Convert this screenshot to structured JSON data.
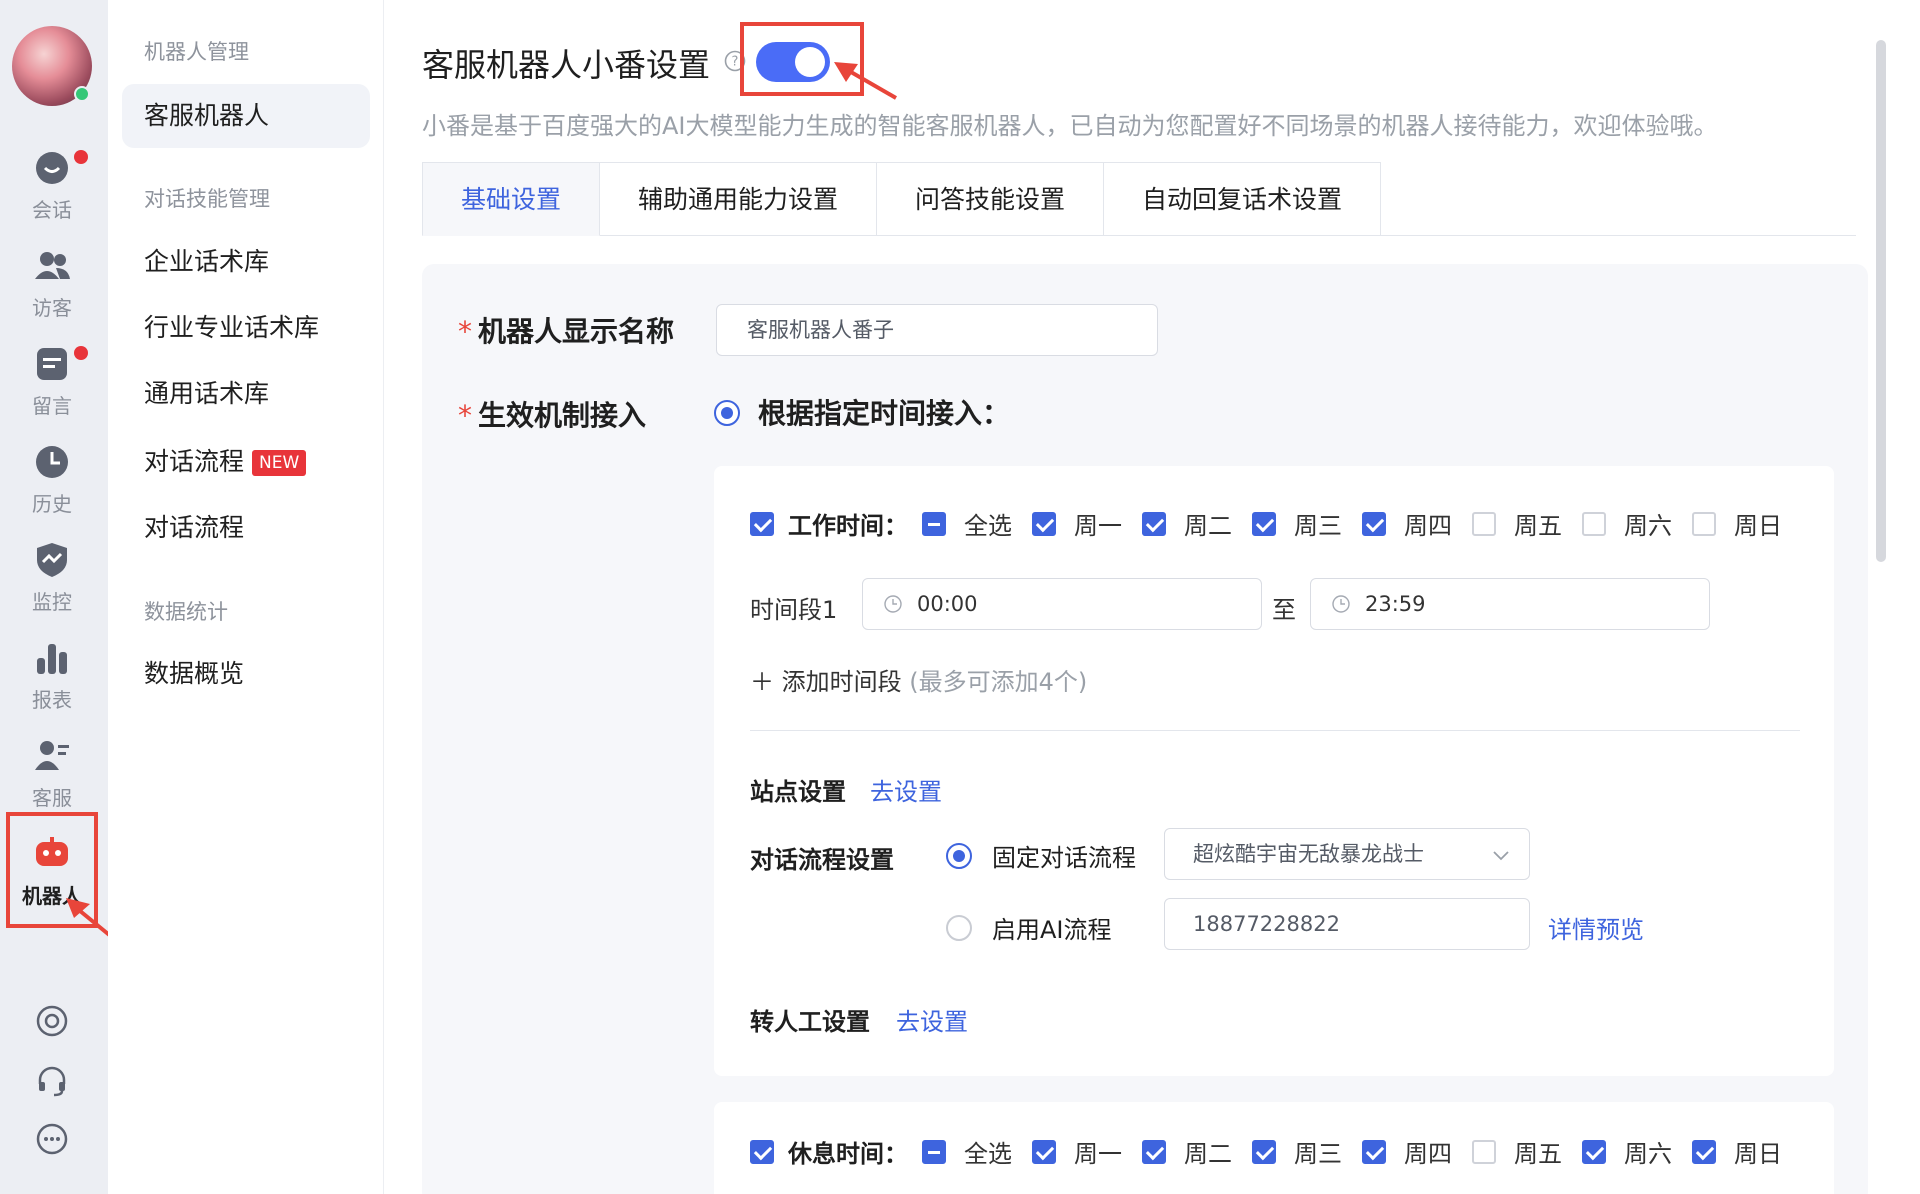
{
  "rail": {
    "items": [
      {
        "label": "会话",
        "badge": true
      },
      {
        "label": "访客",
        "badge": false
      },
      {
        "label": "留言",
        "badge": true
      },
      {
        "label": "历史",
        "badge": false
      },
      {
        "label": "监控",
        "badge": false
      },
      {
        "label": "报表",
        "badge": false
      },
      {
        "label": "客服",
        "badge": false
      },
      {
        "label": "机器人",
        "badge": false,
        "active": true
      }
    ]
  },
  "sidebar": {
    "group1": "机器人管理",
    "item_robot": "客服机器人",
    "group2": "对话技能管理",
    "item_enterprise": "企业话术库",
    "item_industry": "行业专业话术库",
    "item_general": "通用话术库",
    "item_flow_new": "对话流程",
    "new_badge": "NEW",
    "item_flow": "对话流程",
    "group3": "数据统计",
    "item_overview": "数据概览"
  },
  "header": {
    "title": "客服机器人小番设置",
    "toggle_on": true,
    "subtitle": "小番是基于百度强大的AI大模型能力生成的智能客服机器人，已自动为您配置好不同场景的机器人接待能力，欢迎体验哦。"
  },
  "tabs": [
    "基础设置",
    "辅助通用能力设置",
    "问答技能设置",
    "自动回复话术设置"
  ],
  "form": {
    "name_label": "机器人显示名称",
    "name_value": "客服机器人番子",
    "mechanism_label": "生效机制接入",
    "mechanism_option": "根据指定时间接入："
  },
  "work": {
    "label": "工作时间：",
    "select_all": "全选",
    "days": [
      {
        "label": "周一",
        "checked": true
      },
      {
        "label": "周二",
        "checked": true
      },
      {
        "label": "周三",
        "checked": true
      },
      {
        "label": "周四",
        "checked": true
      },
      {
        "label": "周五",
        "checked": false
      },
      {
        "label": "周六",
        "checked": false
      },
      {
        "label": "周日",
        "checked": false
      }
    ],
    "period_label": "时间段1",
    "start": "00:00",
    "to": "至",
    "end": "23:59",
    "add_period": "添加时间段",
    "add_hint": "(最多可添加4个)",
    "site_label": "站点设置",
    "site_link": "去设置",
    "flow_label": "对话流程设置",
    "flow_fixed": "固定对话流程",
    "flow_select": "超炫酷宇宙无敌暴龙战士",
    "flow_ai": "启用AI流程",
    "flow_ai_value": "18877228822",
    "preview_link": "详情预览",
    "transfer_label": "转人工设置",
    "transfer_link": "去设置"
  },
  "rest": {
    "label": "休息时间：",
    "select_all": "全选",
    "days": [
      {
        "label": "周一",
        "checked": true
      },
      {
        "label": "周二",
        "checked": true
      },
      {
        "label": "周三",
        "checked": true
      },
      {
        "label": "周四",
        "checked": true
      },
      {
        "label": "周五",
        "checked": false
      },
      {
        "label": "周六",
        "checked": true
      },
      {
        "label": "周日",
        "checked": true
      }
    ]
  },
  "colors": {
    "accent": "#3e64de",
    "highlight": "#e8453a",
    "badge": "#e8343a"
  }
}
